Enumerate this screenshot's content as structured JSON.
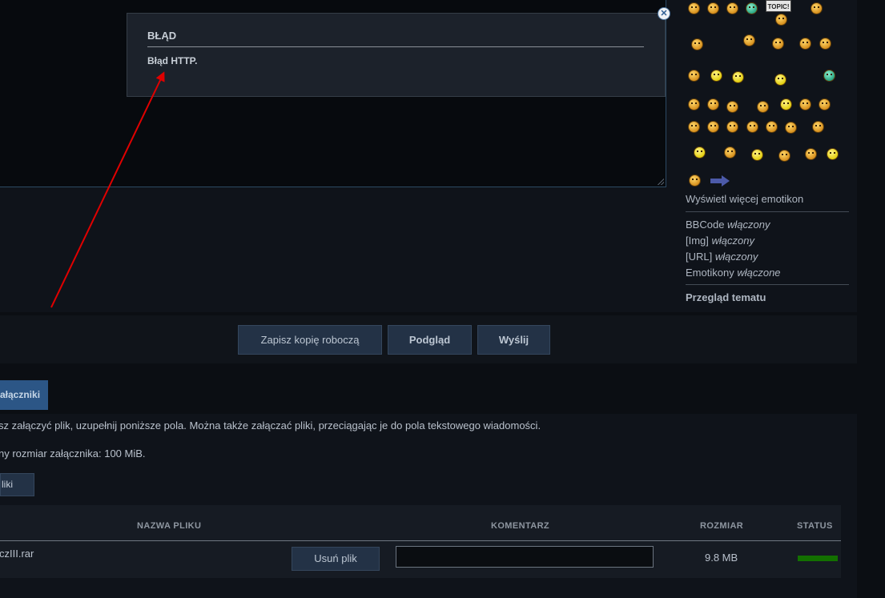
{
  "error_dialog": {
    "title": "BŁĄD",
    "message": "Błąd HTTP."
  },
  "emoticons": {
    "sign_text": "TOPIC!",
    "show_more": "Wyświetl więcej emotikon"
  },
  "post_options": {
    "bbcode": {
      "label": "BBCode",
      "state": "włączony"
    },
    "img": {
      "label": "[Img]",
      "state": "włączony"
    },
    "url": {
      "label": "[URL]",
      "state": "włączony"
    },
    "emoticons": {
      "label": "Emotikony",
      "state": "włączone"
    },
    "topic_review": "Przegląd tematu"
  },
  "buttons": {
    "save_draft": "Zapisz kopię roboczą",
    "preview": "Podgląd",
    "submit": "Wyślij"
  },
  "attachments": {
    "tab_label": "ałączniki",
    "help_text": "sz załączyć plik, uzupełnij poniższe pola. Można także załączać pliki, przeciągając je do pola tekstowego wiadomości.",
    "max_size_text": "ny rozmiar załącznika: 100 MiB.",
    "add_files_label": "liki",
    "columns": {
      "filename": "NAZWA PLIKU",
      "comment": "KOMENTARZ",
      "size": "ROZMIAR",
      "status": "STATUS"
    },
    "rows": [
      {
        "filename": "czIII.rar",
        "delete_label": "Usuń plik",
        "comment": "",
        "size": "9.8 MB",
        "status_progress": 1.0,
        "status_color": "#137000"
      }
    ]
  },
  "colors": {
    "background": "#0b0e13",
    "button": "#233246",
    "tab_active": "#2c5686",
    "annotation_arrow": "#e00000"
  }
}
